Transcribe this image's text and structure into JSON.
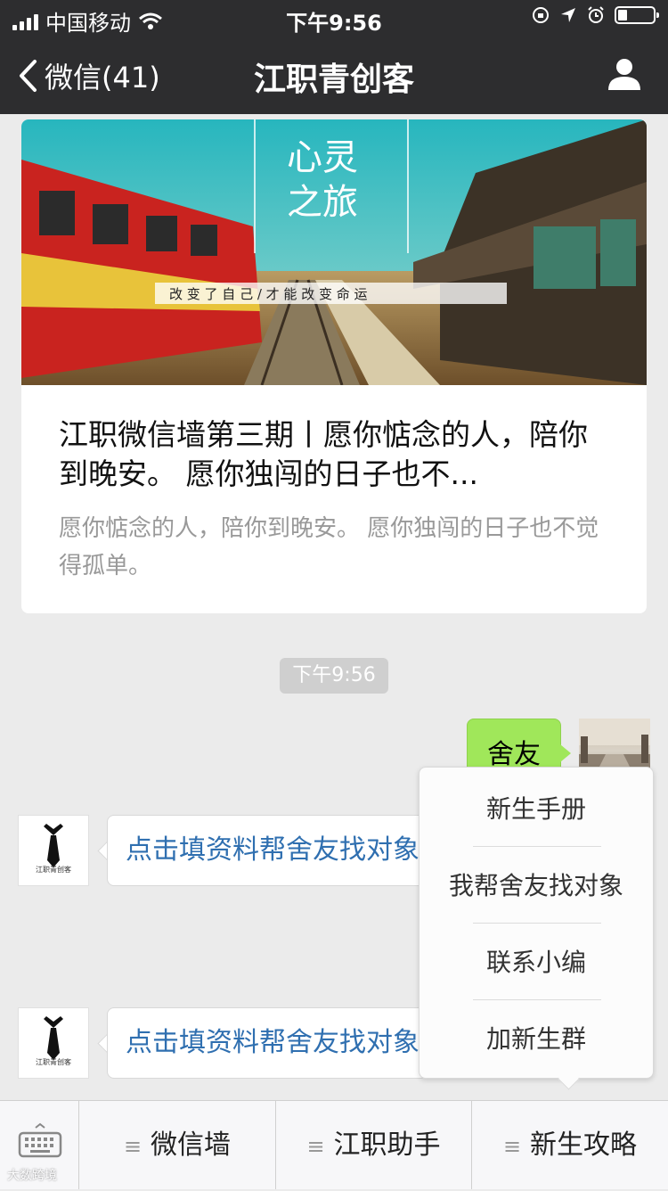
{
  "status_bar": {
    "carrier": "中国移动",
    "time": "下午9:56"
  },
  "nav": {
    "back_label": "微信(41)",
    "title": "江职青创客"
  },
  "article": {
    "banner_title_line1": "心灵",
    "banner_title_line2": "之旅",
    "banner_slogan": "改 变 了 自 己 / 才 能 改 变 命 运",
    "title": "江职微信墙第三期丨愿你惦念的人，陪你到晚安。 愿你独闯的日子也不...",
    "description": "愿你惦念的人，陪你到晚安。 愿你独闯的日子也不觉得孤单。"
  },
  "chat": {
    "timestamp": "下午9:56",
    "outgoing_text": "舍友",
    "bot_caption": "江职青创客",
    "incoming": [
      {
        "text": "点击填资料帮舍友找对象"
      },
      {
        "text": "点击填资料帮舍友找对象"
      }
    ]
  },
  "popup_menu": {
    "items": [
      "新生手册",
      "我帮舍友找对象",
      "联系小编",
      "加新生群"
    ]
  },
  "bottom_menu": {
    "items": [
      "微信墙",
      "江职助手",
      "新生攻略"
    ]
  },
  "watermark": "大数跨境",
  "colors": {
    "nav_bg": "#2d2d2f",
    "outgoing_bubble": "#a0e75a",
    "link_text": "#2f6fb0",
    "chat_bg": "#ebebeb"
  }
}
